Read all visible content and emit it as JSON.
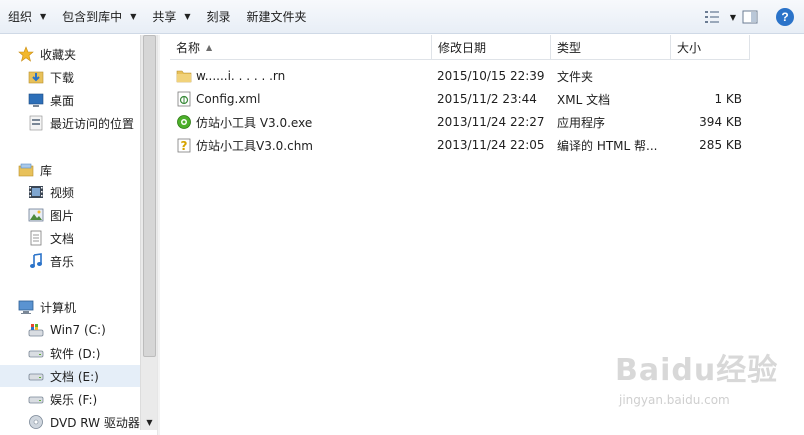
{
  "toolbar": {
    "organize": "组织",
    "include_library": "包含到库中",
    "share": "共享",
    "burn": "刻录",
    "new_folder": "新建文件夹"
  },
  "nav": {
    "favorites": {
      "label": "收藏夹",
      "items": [
        {
          "label": "下载",
          "icon": "download-folder-icon"
        },
        {
          "label": "桌面",
          "icon": "desktop-icon"
        },
        {
          "label": "最近访问的位置",
          "icon": "recent-places-icon"
        }
      ]
    },
    "libraries": {
      "label": "库",
      "items": [
        {
          "label": "视频",
          "icon": "video-icon"
        },
        {
          "label": "图片",
          "icon": "picture-icon"
        },
        {
          "label": "文档",
          "icon": "document-icon"
        },
        {
          "label": "音乐",
          "icon": "music-icon"
        }
      ]
    },
    "computer": {
      "label": "计算机",
      "items": [
        {
          "label": "Win7 (C:)",
          "icon": "system-drive-icon"
        },
        {
          "label": "软件 (D:)",
          "icon": "drive-icon"
        },
        {
          "label": "文档 (E:)",
          "icon": "drive-icon",
          "selected": true
        },
        {
          "label": "娱乐 (F:)",
          "icon": "drive-icon"
        },
        {
          "label": "DVD RW 驱动器",
          "icon": "dvd-drive-icon"
        }
      ]
    }
  },
  "columns": {
    "name": "名称",
    "date": "修改日期",
    "type": "类型",
    "size": "大小"
  },
  "files": [
    {
      "name": "w......i. . . . . .rn",
      "date": "2015/10/15 22:39",
      "type": "文件夹",
      "size": "",
      "icon": "folder-icon"
    },
    {
      "name": "Config.xml",
      "date": "2015/11/2 23:44",
      "type": "XML 文档",
      "size": "1 KB",
      "icon": "xml-file-icon"
    },
    {
      "name": "仿站小工具 V3.0.exe",
      "date": "2013/11/24 22:27",
      "type": "应用程序",
      "size": "394 KB",
      "icon": "exe-app-icon"
    },
    {
      "name": "仿站小工具V3.0.chm",
      "date": "2013/11/24 22:05",
      "type": "编译的 HTML 帮...",
      "size": "285 KB",
      "icon": "chm-help-icon"
    }
  ],
  "watermark": {
    "logo": "Baidu经验",
    "url": "jingyan.baidu.com"
  },
  "colors": {
    "accent": "#2b73c9",
    "selected_bg": "#e5eef8",
    "folder": "#e8c15a"
  }
}
